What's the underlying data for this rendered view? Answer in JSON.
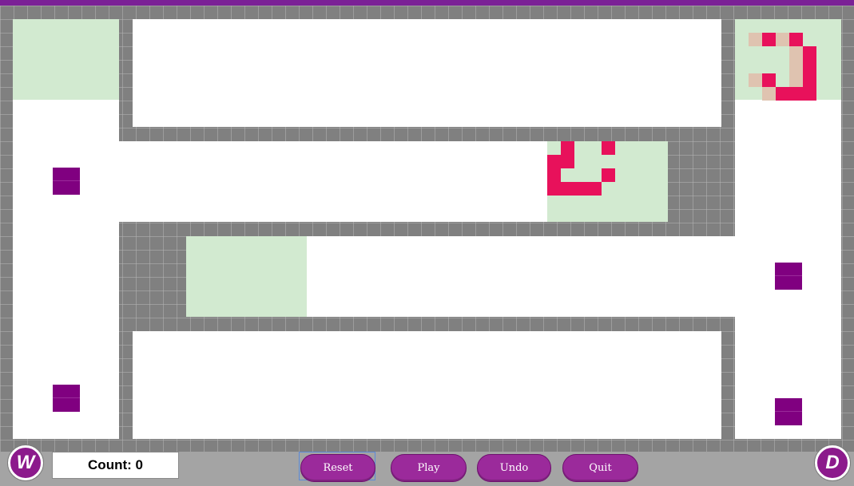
{
  "game": {
    "counter_label": "Count: 0",
    "colors": {
      "wall": "#808080",
      "floor": "#ffffff",
      "goal": "#d2ead0",
      "block": "#800080",
      "snake": "#e8115b",
      "snake_trail": "#dfc3b0",
      "accent": "#7b2196"
    },
    "blocks": 4,
    "goal_zones": 4
  },
  "controls": {
    "left_badge": "W",
    "right_badge": "D",
    "reset_label": "Reset",
    "play_label": "Play",
    "undo_label": "Undo",
    "quit_label": "Quit"
  }
}
